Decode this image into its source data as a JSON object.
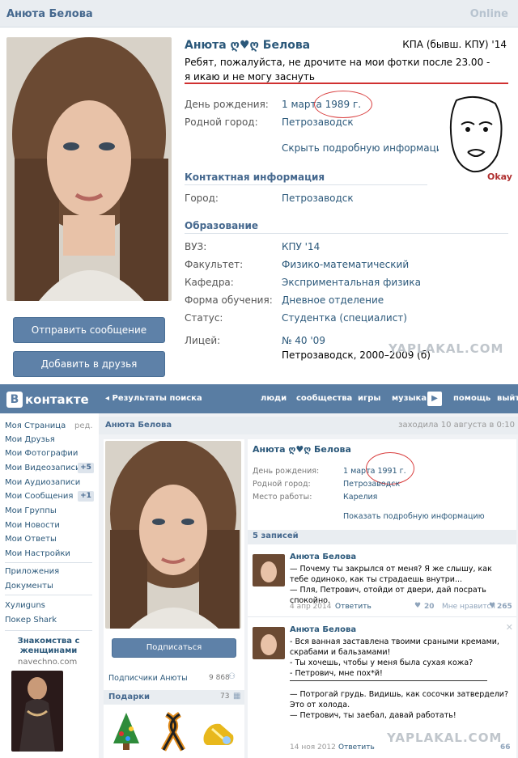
{
  "top": {
    "header_name": "Анюта Белова",
    "header_status": "Online",
    "profile_name": "Анюта ღ♥ღ Белова",
    "school": "КПА (бывш. КПУ) '14",
    "status_text": "Ребят, пожалуйста, не дрочите на мои фотки после 23.00 - я икаю и не могу заснуть",
    "fields": [
      {
        "label": "День рождения:",
        "value": "1 марта 1989 г."
      },
      {
        "label": "Родной город:",
        "value": "Петрозаводск"
      }
    ],
    "hide_info": "Скрыть подробную информацию",
    "contact_title": "Контактная информация",
    "city_label": "Город:",
    "city_value": "Петрозаводск",
    "education_title": "Образование",
    "education": [
      {
        "label": "ВУЗ:",
        "value": "КПУ '14"
      },
      {
        "label": "Факультет:",
        "value": "Физико-математический"
      },
      {
        "label": "Кафедра:",
        "value": "Эксприментальная физика"
      },
      {
        "label": "Форма обучения:",
        "value": "Дневное отделение"
      },
      {
        "label": "Статус:",
        "value": "Студентка (специалист)"
      }
    ],
    "lyceum_label": "Лицей:",
    "lyceum_value": "№ 40 '09",
    "lyceum_detail": "Петрозаводск, 2000–2009 (б)",
    "send_message": "Отправить сообщение",
    "add_friend": "Добавить в друзья",
    "okay_caption": "Okay",
    "watermark": "YAPLAKAL.COM"
  },
  "bottom": {
    "logo_letter": "В",
    "logo_text": "контакте",
    "back_link": "◂ Результаты поиска",
    "nav": [
      "люди",
      "сообщества",
      "игры",
      "музыка",
      "помощь",
      "выйти"
    ],
    "menu": [
      {
        "label": "Моя Страница",
        "extra": "ред."
      },
      {
        "label": "Мои Друзья"
      },
      {
        "label": "Мои Фотографии"
      },
      {
        "label": "Мои Видеозаписи",
        "count": "+5"
      },
      {
        "label": "Мои Аудиозаписи"
      },
      {
        "label": "Мои Сообщения",
        "count": "+1"
      },
      {
        "label": "Мои Группы"
      },
      {
        "label": "Мои Новости"
      },
      {
        "label": "Мои Ответы"
      },
      {
        "label": "Мои Настройки"
      },
      {
        "label": "Приложения"
      },
      {
        "label": "Документы"
      },
      {
        "label": "Хулиguns"
      },
      {
        "label": "Покер Shark"
      }
    ],
    "ad_title": "Знакомства с женщинами",
    "ad_site": "navechno.com",
    "header_name": "Анюта Белова",
    "last_seen": "заходила 10 августа в 0:10",
    "profile_name": "Анюта ღ♥ღ Белова",
    "fields": [
      {
        "label": "День рождения:",
        "value": "1 марта 1991 г."
      },
      {
        "label": "Родной город:",
        "value": "Петрозаводск"
      },
      {
        "label": "Место работы:",
        "value": "Карелия"
      }
    ],
    "show_info": "Показать подробную информацию",
    "subscribe": "Подписаться",
    "followers_label": "Подписчики Анюты",
    "followers_count": "9 868",
    "gifts_label": "Подарки",
    "gifts_count": "73",
    "wall_title": "5 записей",
    "posts": [
      {
        "author": "Анюта Белова",
        "text": "— Почему ты закрылся от меня? Я же слышу, как тебе одиноко, как ты страдаешь внутри...\n— Пля, Петрович, отойди от двери, дай посрать спокойно.",
        "date": "4 апр 2014",
        "reply": "Ответить",
        "likes": "20",
        "liked_label": "Мне нравится",
        "shares": "265"
      },
      {
        "author": "Анюта Белова",
        "text": "- Вся ванная заставлена твоими сраными кремами, скрабами и бальзамами!\n- Ты хочешь, чтобы у меня была сухая кожа?\n- Петрович, мне пох*й!\n\n— Потрогай грудь. Видишь, как сосочки затвердели? Это от холода.\n— Петрович, ты заебал, давай работать!",
        "date": "14 ноя 2012",
        "reply": "Ответить",
        "shares": "66"
      }
    ],
    "watermark": "YAPLAKAL.COM"
  }
}
